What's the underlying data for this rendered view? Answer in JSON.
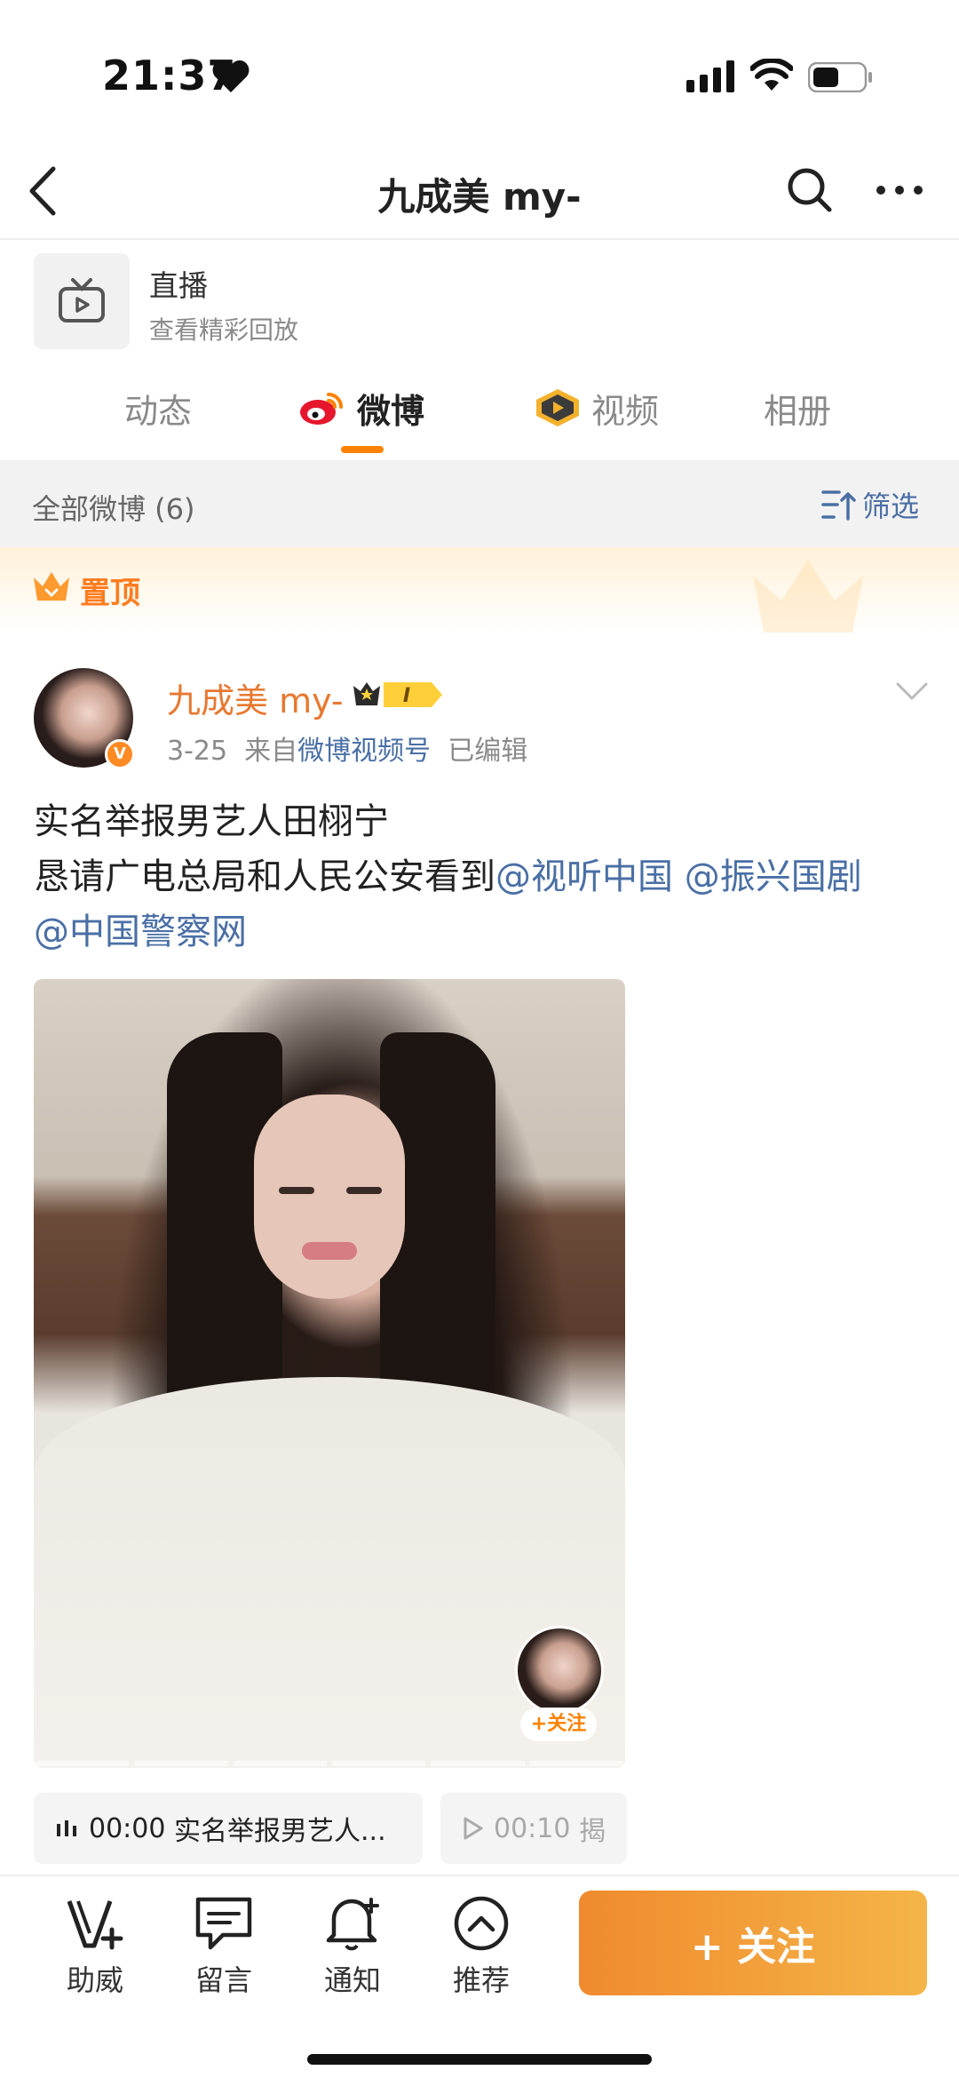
{
  "status_bar": {
    "time": "21:37"
  },
  "nav": {
    "title": "九成美 my-"
  },
  "live": {
    "title": "直播",
    "subtitle": "查看精彩回放"
  },
  "tabs": [
    {
      "label": "动态"
    },
    {
      "label": "微博"
    },
    {
      "label": "视频"
    },
    {
      "label": "相册"
    }
  ],
  "filter": {
    "count_label": "全部微博 (6)",
    "button_label": "筛选"
  },
  "pinned": {
    "label": "置顶"
  },
  "post": {
    "author": "九成美 my-",
    "vip_level": "I",
    "date": "3-25",
    "source_prefix": "来自",
    "source": "微博视频号",
    "edited": "已编辑",
    "line1": "实名举报男艺人田栩宁",
    "line2_text": "恳请广电总局和人民公安看到",
    "mention1": "@视听中国",
    "mention2": "@振兴国剧",
    "mention3": "@中国警察网",
    "mini_follow": "+关注"
  },
  "chips": [
    {
      "time": "00:00",
      "title": "实名举报男艺人..."
    },
    {
      "time": "00:10",
      "title": "揭"
    }
  ],
  "bottom_bar": {
    "items": [
      {
        "label": "助威"
      },
      {
        "label": "留言"
      },
      {
        "label": "通知"
      },
      {
        "label": "推荐"
      }
    ],
    "follow_label": "+ 关注"
  },
  "colors": {
    "accent": "#ff8200",
    "link": "#4a6fa5",
    "author": "#e8782f"
  }
}
